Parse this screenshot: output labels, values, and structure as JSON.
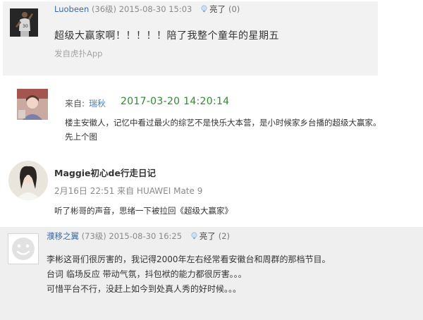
{
  "comments": [
    {
      "username": "Luobeen",
      "level": "(36级)",
      "timestamp": "2015-08-30 15:03",
      "likes_label": "亮了",
      "likes_count": "(0)",
      "text": "超级大赢家啊！！！！！陪了我整个童年的星期五",
      "source": "发自虎扑App",
      "avatar_icon": "basketball-player-photo"
    },
    {
      "from_label": "来自:",
      "username": "瑞秋",
      "timestamp": "2017-03-20 14:20:14",
      "text_line1": "楼主安徽人，记忆中看过最火的综艺不是快乐大本营，是小时候家乡台播的超级大赢家。",
      "text_line2": "先上个图",
      "avatar_icon": "girl-photo"
    },
    {
      "username": "Maggie初心de行走日记",
      "meta": "2月16日 22:51 来自 HUAWEI Mate 9",
      "text": "听了彬哥的声音，思绪一下被拉回《超级大赢家》",
      "avatar_icon": "woman-portrait-photo"
    },
    {
      "username": "濮移之翼",
      "level": "(73级)",
      "timestamp": "2015-08-30 16:25",
      "likes_label": "亮了",
      "likes_count": "(2)",
      "text_line1": "李彬这哥们很厉害的，我记得2000年左右经常看安徽台和周群的那档节目。",
      "text_line2": "台词 临场反应 带动气氛，抖包袱的能力都很厉害。。。",
      "text_line3": "可惜平台不行，没赶上如今到处真人秀的好时候。。。",
      "avatar_icon": "default-smiley-avatar"
    }
  ],
  "colors": {
    "link_blue": "#3b6aa0",
    "time_green": "#2e8b2e",
    "gray_text": "#8a8a8a",
    "panel_gray": "#f2f2f2"
  }
}
